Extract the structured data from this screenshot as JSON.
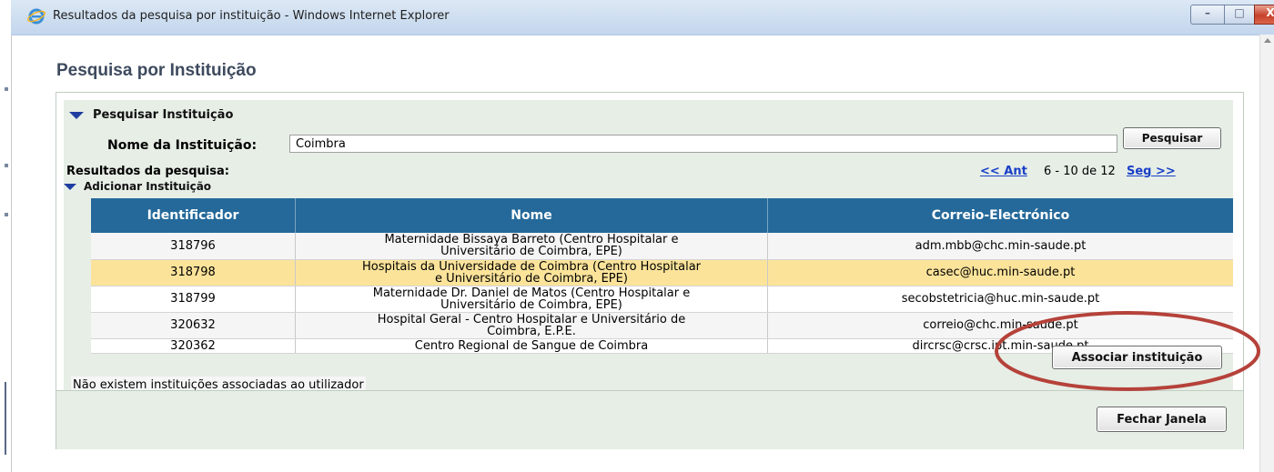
{
  "window": {
    "title": "Resultados da pesquisa por instituição - Windows Internet Explorer",
    "buttons": {
      "minimize": "–",
      "maximize": "□",
      "close": "X"
    }
  },
  "page": {
    "title": "Pesquisa por Instituição"
  },
  "search": {
    "section_title": "Pesquisar Instituição",
    "field_label": "Nome da Instituição:",
    "value": "Coimbra",
    "button_label": "Pesquisar"
  },
  "results": {
    "label": "Resultados da pesquisa:",
    "pager": {
      "prev": "<< Ant",
      "range": "6 - 10 de 12",
      "next": "Seg >>"
    },
    "section_title": "Adicionar Instituição",
    "columns": [
      "Identificador",
      "Nome",
      "Correio-Electrónico"
    ],
    "rows": [
      {
        "id": "318796",
        "nome": "Maternidade Bissaya Barreto (Centro Hospitalar e Universitário de Coimbra, EPE)",
        "email": "adm.mbb@chc.min-saude.pt"
      },
      {
        "id": "318798",
        "nome": "Hospitais da Universidade de Coimbra (Centro Hospitalar e Universitário de Coimbra, EPE)",
        "email": "casec@huc.min-saude.pt"
      },
      {
        "id": "318799",
        "nome": "Maternidade Dr. Daniel de Matos (Centro Hospitalar e Universitário de Coimbra, EPE)",
        "email": "secobstetricia@huc.min-saude.pt"
      },
      {
        "id": "320632",
        "nome": "Hospital Geral - Centro Hospitalar e Universitário de Coimbra, E.P.E.",
        "email": "correio@chc.min-saude.pt"
      },
      {
        "id": "320362",
        "nome": "Centro Regional de Sangue de Coimbra",
        "email": "dircrsc@crsc.ipt.min-saude.pt"
      }
    ],
    "selected_row": 1,
    "associate_button": "Associar instituição"
  },
  "status": {
    "no_associations": "Não existem instituições associadas ao utilizador"
  },
  "footer": {
    "close_button": "Fechar Janela"
  },
  "colors": {
    "header_blue": "#24699a",
    "selected_row": "#fbe39a",
    "panel_green": "#e6eee6",
    "annotation_red": "#b5423a",
    "link_blue": "#1a3fc7"
  },
  "icons": [
    "internet-explorer-icon",
    "collapse-triangle-icon"
  ]
}
